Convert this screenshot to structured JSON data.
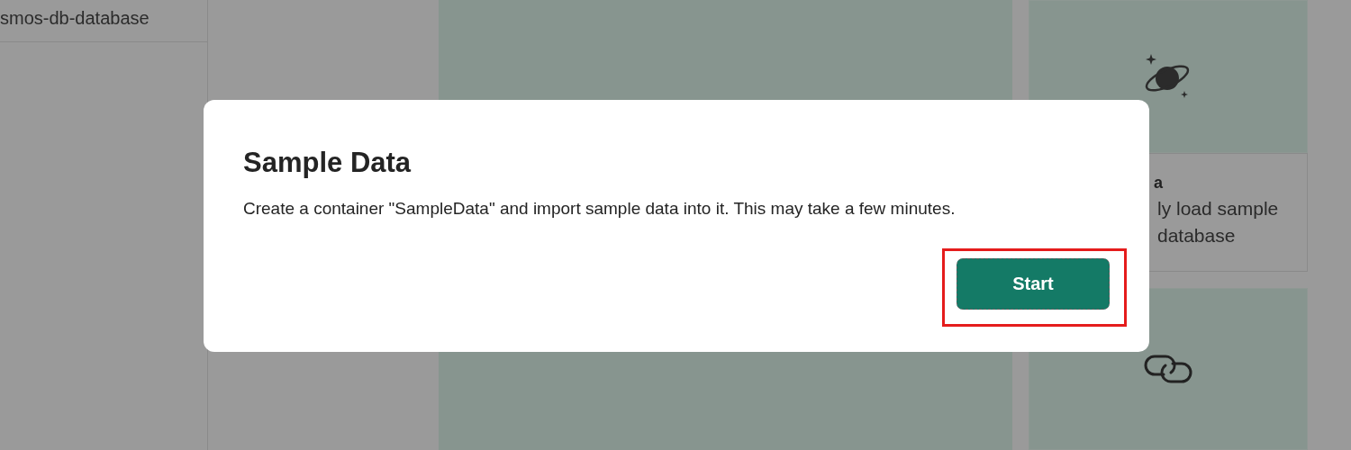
{
  "sidebar": {
    "title": "smos-db-database"
  },
  "cards": [
    {
      "kind": "planet"
    },
    {
      "kind": "text",
      "title": "a",
      "lines": [
        "ly load sample",
        "database"
      ]
    },
    {
      "kind": "link"
    }
  ],
  "dialog": {
    "title": "Sample Data",
    "message": "Create a container \"SampleData\" and import sample data into it. This may take a few minutes.",
    "button": "Start"
  }
}
